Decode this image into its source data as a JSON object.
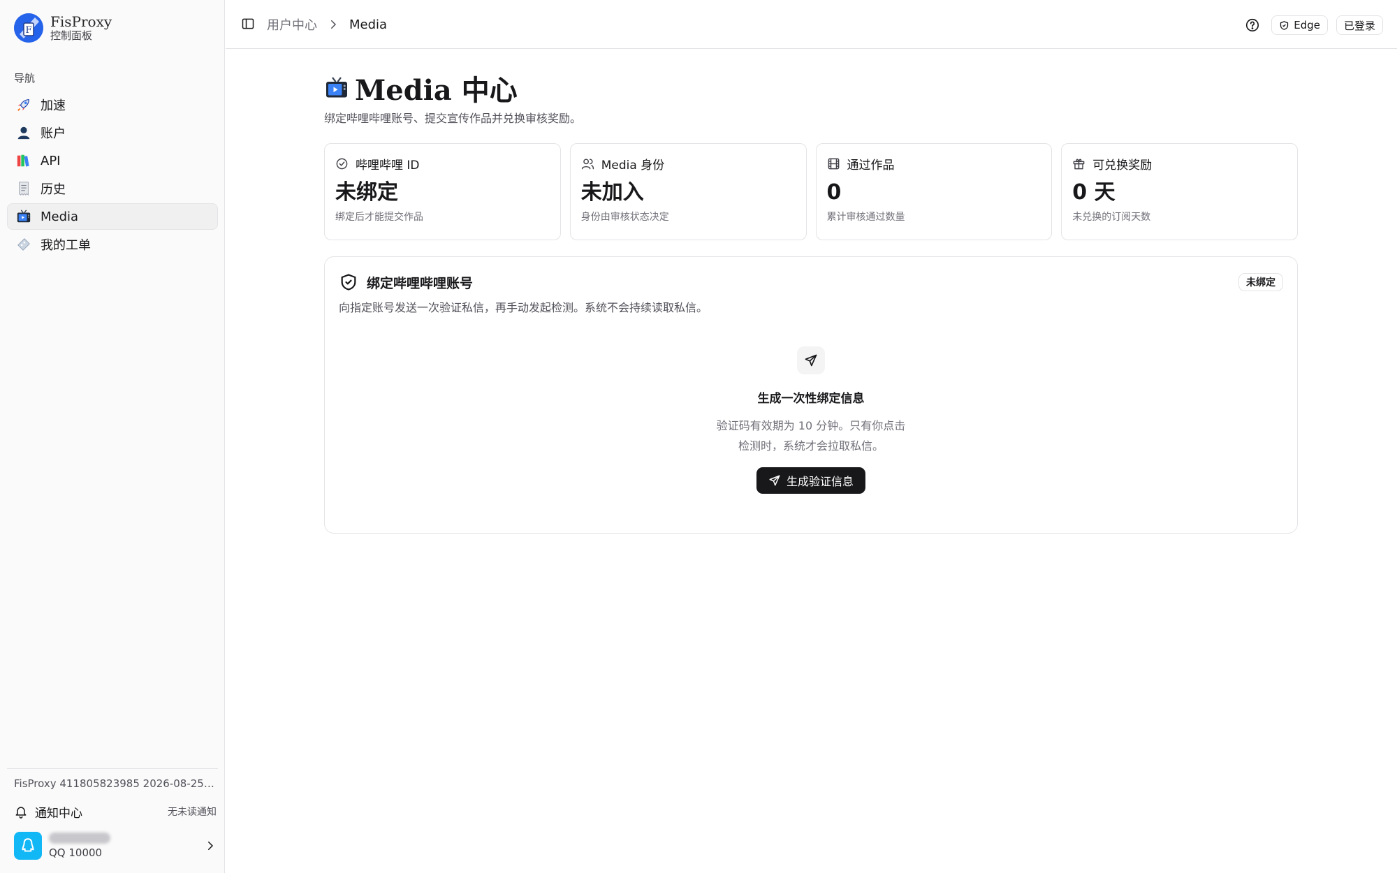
{
  "brand": {
    "name": "FisProxy",
    "subtitle": "控制面板"
  },
  "sidebar": {
    "section_label": "导航",
    "items": [
      {
        "label": "加速",
        "icon": "rocket-icon",
        "active": false
      },
      {
        "label": "账户",
        "icon": "user-silhouette-icon",
        "active": false
      },
      {
        "label": "API",
        "icon": "books-icon",
        "active": false
      },
      {
        "label": "历史",
        "icon": "receipt-icon",
        "active": false
      },
      {
        "label": "Media",
        "icon": "tv-icon",
        "active": true
      },
      {
        "label": "我的工单",
        "icon": "ticket-icon",
        "active": false
      }
    ],
    "footer": {
      "build": "FisProxy 411805823985 2026-08-25T1…",
      "notify_label": "通知中心",
      "notify_status": "无未读通知",
      "user_sub": "QQ 10000"
    }
  },
  "topbar": {
    "breadcrumb_parent": "用户中心",
    "breadcrumb_current": "Media",
    "edge_label": "Edge",
    "login_label": "已登录"
  },
  "page": {
    "title": "Media 中心",
    "description": "绑定哔哩哔哩账号、提交宣传作品并兑换审核奖励。"
  },
  "stats": [
    {
      "label": "哔哩哔哩 ID",
      "value": "未绑定",
      "sub": "绑定后才能提交作品",
      "icon": "check-circle-icon"
    },
    {
      "label": "Media 身份",
      "value": "未加入",
      "sub": "身份由审核状态决定",
      "icon": "users-icon"
    },
    {
      "label": "通过作品",
      "value": "0",
      "sub": "累计审核通过数量",
      "icon": "film-icon"
    },
    {
      "label": "可兑换奖励",
      "value": "0 天",
      "sub": "未兑换的订阅天数",
      "icon": "gift-icon"
    }
  ],
  "bind": {
    "title": "绑定哔哩哔哩账号",
    "description": "向指定账号发送一次验证私信，再手动发起检测。系统不会持续读取私信。",
    "badge": "未绑定",
    "sub_title": "生成一次性绑定信息",
    "note": "验证码有效期为 10 分钟。只有你点击检测时，系统才会拉取私信。",
    "button_label": "生成验证信息"
  },
  "colors": {
    "accent": "#18181b",
    "border": "#e4e4e7",
    "muted": "#71717a",
    "qq_blue": "#12b7f5"
  }
}
